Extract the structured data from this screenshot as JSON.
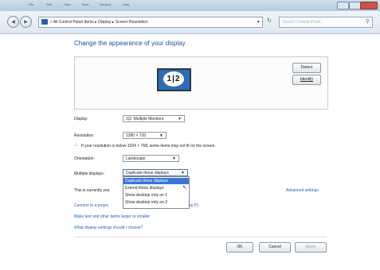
{
  "window": {
    "menu": [
      "File",
      "Edit",
      "View",
      "Tools",
      "Window",
      "Help"
    ]
  },
  "address": {
    "prefix": "«",
    "crumbs": [
      "All Control Panel Items",
      "Display",
      "Screen Resolution"
    ],
    "sep": "▸",
    "search_placeholder": "Search Control Panel"
  },
  "page": {
    "heading": "Change the appearance of your display",
    "detect_label": "Detect",
    "identify_label": "Identify",
    "monitor_label": "1|2"
  },
  "form": {
    "display_label": "Display:",
    "display_value": "1|2. Multiple Monitors",
    "resolution_label": "Resolution:",
    "resolution_value": "1280 × 720",
    "warning_text": "If your resolution is below 1024 × 768, some items may not fit on the screen.",
    "orientation_label": "Orientation:",
    "orientation_value": "Landscape",
    "multiple_label": "Multiple displays:",
    "multiple_value": "Duplicate these displays",
    "multiple_options": [
      "Duplicate these displays",
      "Extend these displays",
      "Show desktop only on 1",
      "Show desktop only on 2"
    ],
    "current_text": "This is currently you",
    "advanced_link": "Advanced settings"
  },
  "links": {
    "projector_start": "Connect to a projec",
    "projector_end": "ep P)",
    "larger_text": "Make text and other items larger or smaller",
    "choose_settings": "What display settings should I choose?"
  },
  "buttons": {
    "ok": "OK",
    "cancel": "Cancel",
    "apply": "Apply"
  },
  "colors": {
    "accent_link": "#1d5fbf",
    "heading": "#1f4e9a",
    "selection": "#3875d7",
    "warning": "#e4a700"
  }
}
